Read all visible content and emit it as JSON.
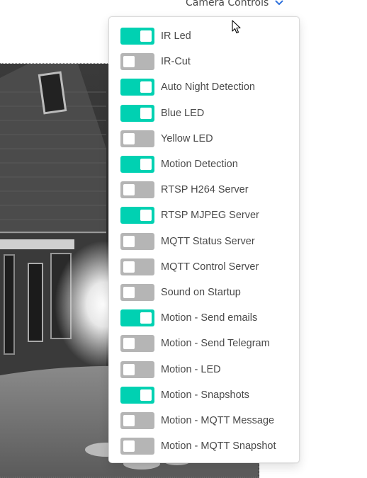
{
  "header": {
    "menu_label": "Camera Controls",
    "menu_icon": "chevron-down-icon",
    "accent_color": "#3273dc"
  },
  "camera": {
    "description_icon": "camera-feed-image"
  },
  "toggle_colors": {
    "on": "#00d1b2",
    "off": "#b5b5b5"
  },
  "controls": [
    {
      "label": "IR Led",
      "on": true
    },
    {
      "label": "IR-Cut",
      "on": false
    },
    {
      "label": "Auto Night Detection",
      "on": true
    },
    {
      "label": "Blue LED",
      "on": true
    },
    {
      "label": "Yellow LED",
      "on": false
    },
    {
      "label": "Motion Detection",
      "on": true
    },
    {
      "label": "RTSP H264 Server",
      "on": false
    },
    {
      "label": "RTSP MJPEG Server",
      "on": true
    },
    {
      "label": "MQTT Status Server",
      "on": false
    },
    {
      "label": "MQTT Control Server",
      "on": false
    },
    {
      "label": "Sound on Startup",
      "on": false
    },
    {
      "label": "Motion - Send emails",
      "on": true
    },
    {
      "label": "Motion - Send Telegram",
      "on": false
    },
    {
      "label": "Motion - LED",
      "on": false
    },
    {
      "label": "Motion - Snapshots",
      "on": true
    },
    {
      "label": "Motion - MQTT Message",
      "on": false
    },
    {
      "label": "Motion - MQTT Snapshot",
      "on": false
    }
  ]
}
